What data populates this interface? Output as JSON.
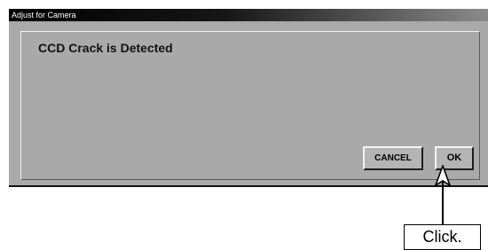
{
  "window": {
    "title": "Adjust for Camera"
  },
  "dialog": {
    "message": "CCD Crack is Detected",
    "cancel_label": "CANCEL",
    "ok_label": "OK"
  },
  "annotation": {
    "callout_text": "Click."
  }
}
